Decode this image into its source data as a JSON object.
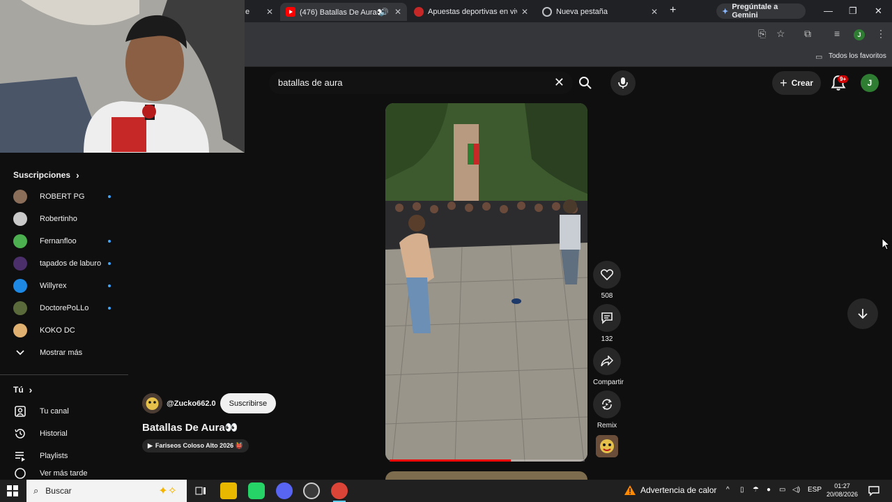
{
  "browser": {
    "tabs": [
      {
        "title": "e",
        "active": false
      },
      {
        "title": "(476) Batallas De Aura👀",
        "active": true
      },
      {
        "title": "Apuestas deportivas en vivo |",
        "active": false
      },
      {
        "title": "Nueva pestaña",
        "active": false
      }
    ],
    "gemini_label": "Pregúntale a Gemini",
    "bookmarks_label": "Todos los favoritos",
    "profile_initial": "J"
  },
  "header": {
    "search_query": "batallas de aura",
    "create_label": "Crear",
    "notifications_badge": "9+",
    "account_initial": "J"
  },
  "sidebar": {
    "subscriptions_heading": "Suscripciones",
    "subscriptions": [
      {
        "name": "ROBERT PG",
        "new": true,
        "color": "#8a6e5a"
      },
      {
        "name": "Robertinho",
        "new": false,
        "color": "#c9c9c9"
      },
      {
        "name": "Fernanfloo",
        "new": true,
        "color": "#4caf50"
      },
      {
        "name": "tapados de laburo",
        "new": true,
        "color": "#4a2f6a"
      },
      {
        "name": "Willyrex",
        "new": true,
        "color": "#1e88e5"
      },
      {
        "name": "DoctorePoLLo",
        "new": true,
        "color": "#5a6a3a"
      },
      {
        "name": "KOKO DC",
        "new": false,
        "color": "#e0b070"
      }
    ],
    "show_more_label": "Mostrar más",
    "you_heading": "Tú",
    "you_items": [
      {
        "label": "Tu canal",
        "icon": "channel-icon"
      },
      {
        "label": "Historial",
        "icon": "history-icon"
      },
      {
        "label": "Playlists",
        "icon": "playlists-icon"
      },
      {
        "label": "Ver más tarde",
        "icon": "watch-later-icon"
      }
    ]
  },
  "short": {
    "channel_handle": "@Zucko662.0",
    "subscribe_label": "Suscribirse",
    "title": "Batallas De Aura👀",
    "sound_label": "Fariseos Coloso Alto 2026 👹",
    "likes": "508",
    "comments": "132",
    "share_label": "Compartir",
    "remix_label": "Remix",
    "progress_fraction": 0.62
  },
  "taskbar": {
    "search_placeholder": "Buscar",
    "weather_label": "Advertencia de calor",
    "language": "ESP",
    "time": "01:27",
    "date": "20/08/2026"
  },
  "colors": {
    "youtube_bg": "#0f0f0f",
    "accent_red": "#ff0000",
    "new_dot": "#3ea6ff"
  }
}
